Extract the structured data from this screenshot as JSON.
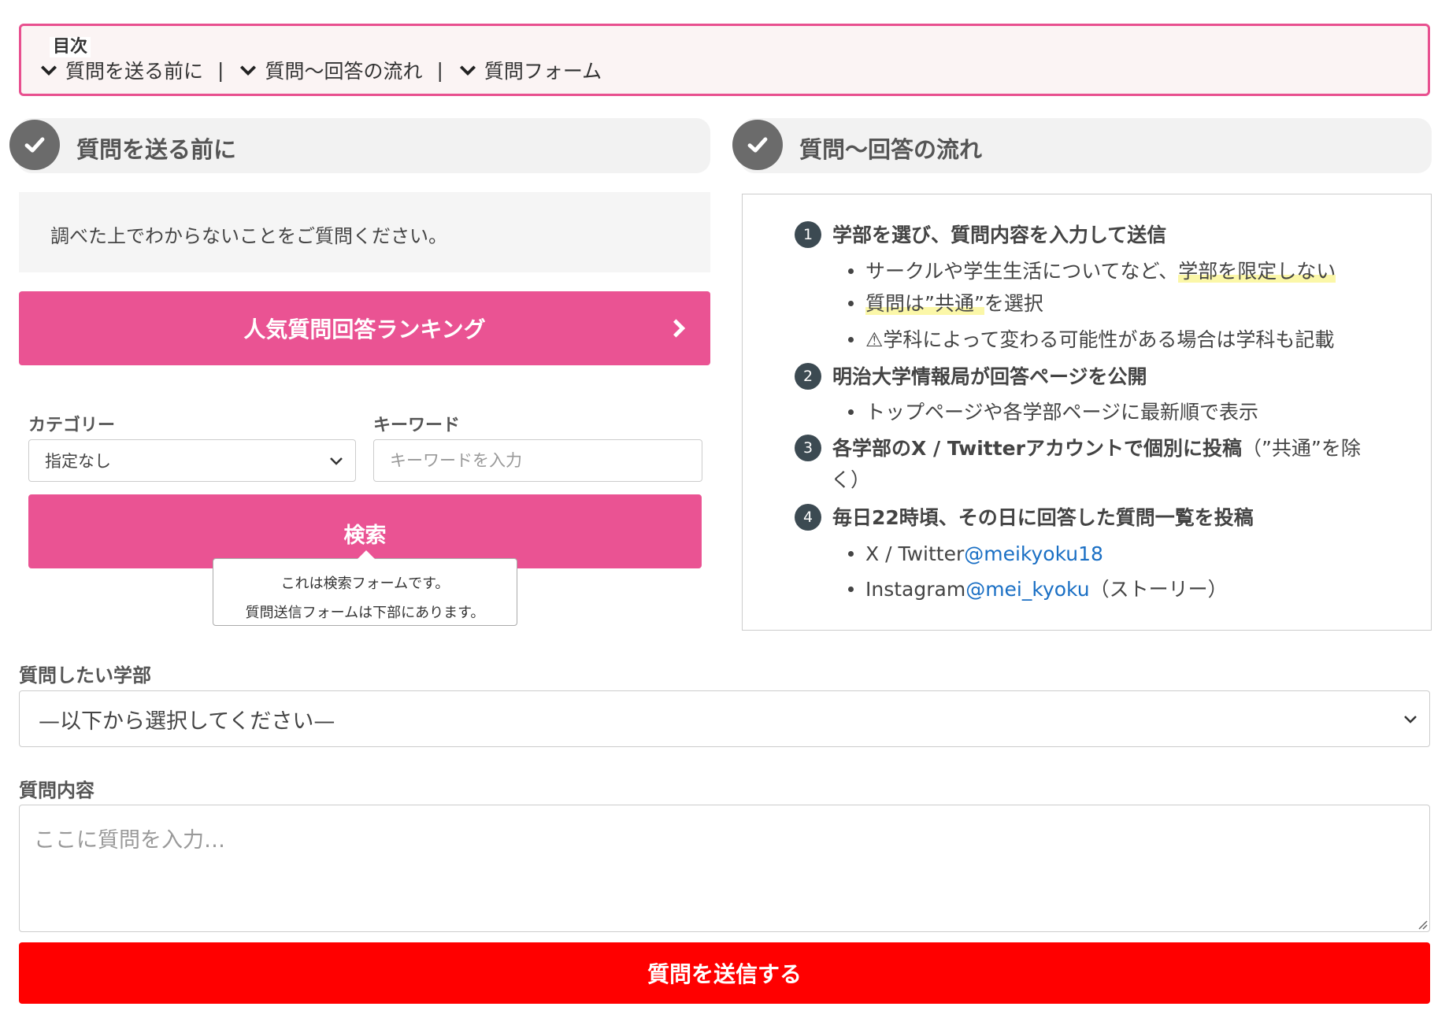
{
  "toc": {
    "title": "目次",
    "items": [
      "質問を送る前に",
      "質問〜回答の流れ",
      "質問フォーム"
    ],
    "separator": "|"
  },
  "left_section": {
    "title": "質問を送る前に",
    "info": "調べた上でわからないことをご質問ください。",
    "ranking_button": "人気質問回答ランキング"
  },
  "search": {
    "category_label": "カテゴリー",
    "category_value": "指定なし",
    "keyword_label": "キーワード",
    "keyword_placeholder": "キーワードを入力",
    "button": "検索",
    "tooltip_line1": "これは検索フォームです。",
    "tooltip_line2": "質問送信フォームは下部にあります。"
  },
  "right_section": {
    "title": "質問〜回答の流れ",
    "steps": [
      {
        "num": "1",
        "text": "学部を選び、質問内容を入力して送信",
        "bullets": {
          "b1_pre": "サークルや学生生活についてなど、",
          "b1_hl1": "学部を限定しない",
          "b1_hl2": "質問は”共通”",
          "b1_post": "を選択",
          "b2": "⚠学科によって変わる可能性がある場合は学科も記載"
        }
      },
      {
        "num": "2",
        "text": "明治大学情報局が回答ページを公開",
        "bullet": "トップページや各学部ページに最新順で表示"
      },
      {
        "num": "3",
        "text": "各学部のX / Twitterアカウントで個別に投稿",
        "note": "（”共通”を除",
        "note2": "く）"
      },
      {
        "num": "4",
        "text": "毎日22時頃、その日に回答した質問一覧を投稿",
        "b1_pre": "X / Twitter",
        "b1_link": "@meikyoku18",
        "b2_pre": "Instagram",
        "b2_link": "@mei_kyoku",
        "b2_post": "（ストーリー）"
      }
    ]
  },
  "form": {
    "faculty_label": "質問したい学部",
    "faculty_value": "—以下から選択してください—",
    "content_label": "質問内容",
    "content_placeholder": "ここに質問を入力…",
    "submit": "質問を送信する"
  },
  "colors": {
    "accent_pink": "#ea5393",
    "toc_border": "#e8508f",
    "submit_red": "#ff0000",
    "link_blue": "#1a6fc4",
    "step_badge": "#3c4a52"
  }
}
